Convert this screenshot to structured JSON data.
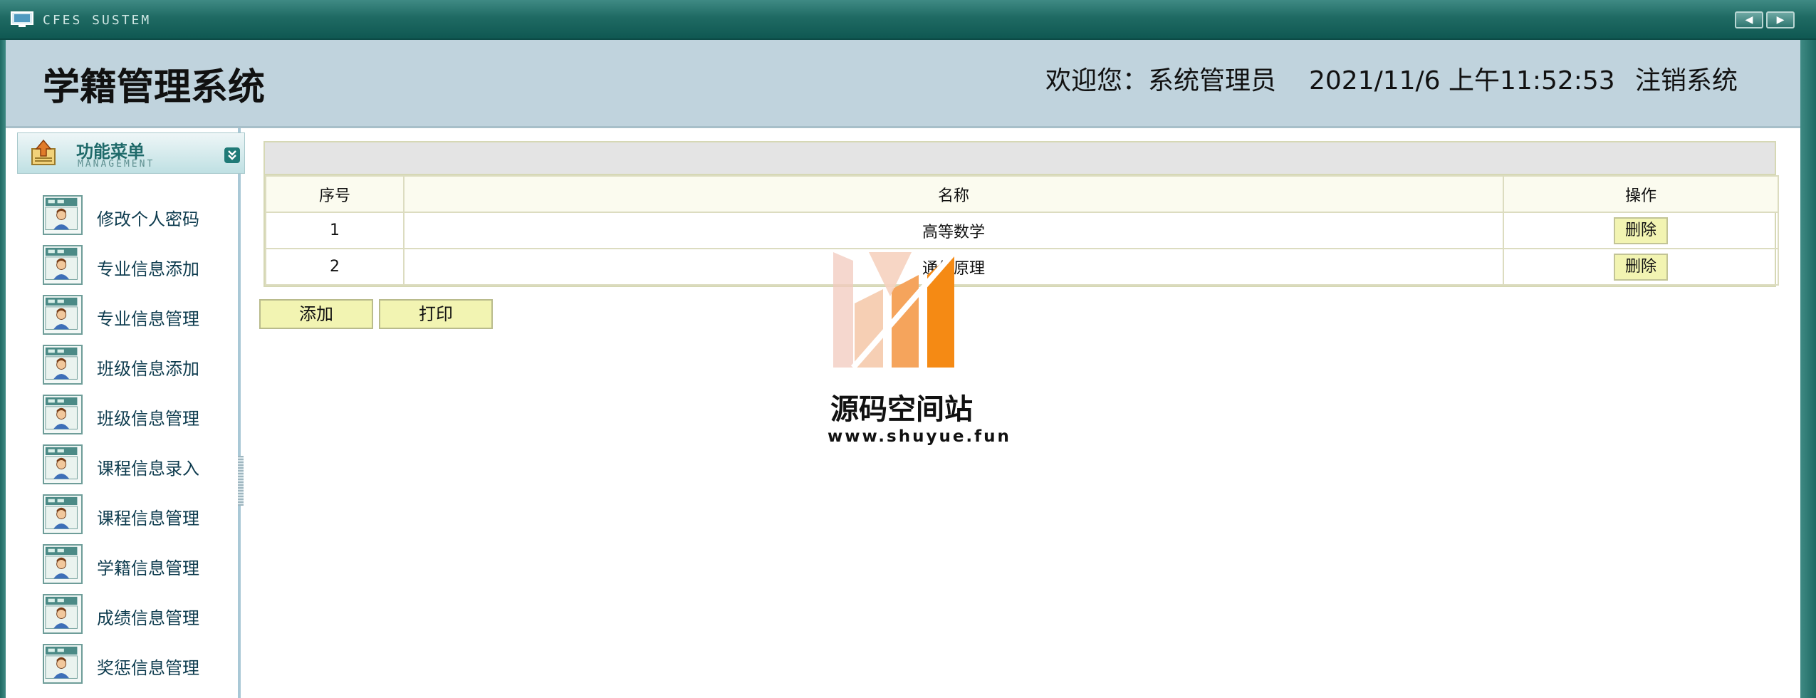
{
  "window": {
    "system_label": "CFES SUSTEM",
    "nav_prev": "◀",
    "nav_next": "▶"
  },
  "header": {
    "app_title": "学籍管理系统",
    "welcome": "欢迎您：系统管理员",
    "datetime": "2021/11/6 上午11:52:53",
    "logout": "注销系统"
  },
  "sidebar": {
    "menu_title": "功能菜单",
    "menu_subtitle": "MANAGEMENT",
    "collapse_icon": "double-chevron-down-icon",
    "items": [
      {
        "label": "修改个人密码",
        "icon": "user-card-icon"
      },
      {
        "label": "专业信息添加",
        "icon": "user-card-icon"
      },
      {
        "label": "专业信息管理",
        "icon": "user-card-icon"
      },
      {
        "label": "班级信息添加",
        "icon": "user-card-icon"
      },
      {
        "label": "班级信息管理",
        "icon": "user-card-icon"
      },
      {
        "label": "课程信息录入",
        "icon": "user-card-icon"
      },
      {
        "label": "课程信息管理",
        "icon": "user-card-icon"
      },
      {
        "label": "学籍信息管理",
        "icon": "user-card-icon"
      },
      {
        "label": "成绩信息管理",
        "icon": "user-card-icon"
      },
      {
        "label": "奖惩信息管理",
        "icon": "user-card-icon"
      }
    ]
  },
  "table": {
    "columns": [
      "序号",
      "名称",
      "操作"
    ],
    "rows": [
      {
        "no": "1",
        "name": "高等数学",
        "action": "删除"
      },
      {
        "no": "2",
        "name": "通信原理",
        "action": "删除"
      }
    ]
  },
  "actions": {
    "add": "添加",
    "print": "打印"
  },
  "watermark": {
    "name": "源码空间站",
    "url": "www.shuyue.fun"
  },
  "colors": {
    "titlebar": "#1f6a63",
    "header_bg": "#c0d3dd",
    "button_bg": "#f2f4b2",
    "table_header_bg": "#fbfbef"
  }
}
